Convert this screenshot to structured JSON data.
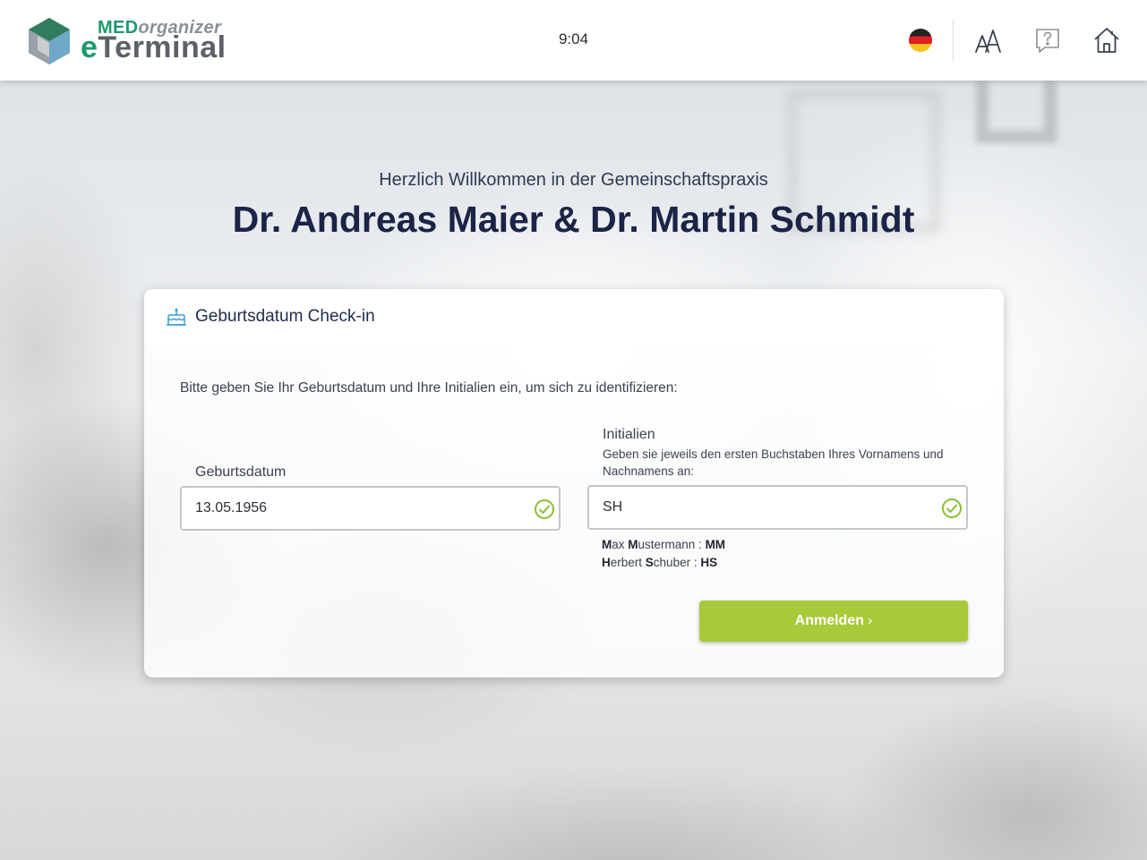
{
  "header": {
    "logo_top_med": "MED",
    "logo_top_org": "organizer",
    "logo_bottom_e": "e",
    "logo_bottom_rest": "Terminal",
    "time": "9:04",
    "language_icon": "german-flag-icon",
    "icons": [
      "font-size-icon",
      "help-icon",
      "home-icon"
    ]
  },
  "welcome": {
    "subtitle": "Herzlich Willkommen in der Gemeinschaftspraxis",
    "practice_name": "Dr. Andreas Maier & Dr. Martin Schmidt"
  },
  "card": {
    "title": "Geburtsdatum Check-in",
    "icon": "birthday-cake-icon",
    "instructions": "Bitte geben Sie Ihr Geburtsdatum und Ihre Initialien ein, um sich zu identifizieren:",
    "birthdate": {
      "label": "Geburtsdatum",
      "value": "13.05.1956"
    },
    "initials": {
      "label": "Initialien",
      "hint": "Geben sie jeweils den ersten Buchstaben Ihres Vornamens und Nachnamens an:",
      "value": "SH",
      "examples": [
        {
          "first_initial": "M",
          "first_rest": "ax ",
          "last_initial": "M",
          "last_rest": "ustermann : ",
          "code": "MM"
        },
        {
          "first_initial": "H",
          "first_rest": "erbert ",
          "last_initial": "S",
          "last_rest": "chuber : ",
          "code": "HS"
        }
      ]
    },
    "submit_label": "Anmelden",
    "submit_chevron": "›"
  },
  "colors": {
    "accent_green": "#a8ca3a",
    "brand_green": "#1c9a6b",
    "heading_navy": "#1b2447",
    "valid_check": "#8bbf2a"
  }
}
